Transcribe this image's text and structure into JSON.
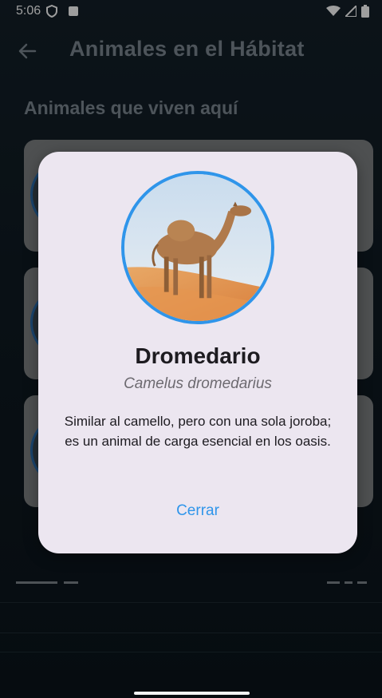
{
  "status_bar": {
    "time": "5:06"
  },
  "app_bar": {
    "title": "Animales en el Hábitat"
  },
  "main": {
    "section_title": "Animales que viven aquí"
  },
  "dialog": {
    "name": "Dromedario",
    "scientific_name": "Camelus dromedarius",
    "description": "Similar al camello, pero con una sola joroba; es un animal de carga esencial en los oasis.",
    "close_label": "Cerrar"
  },
  "colors": {
    "accent": "#2f95ea",
    "dialog_bg": "#ece6f0",
    "app_bg": "#0f1a22"
  }
}
